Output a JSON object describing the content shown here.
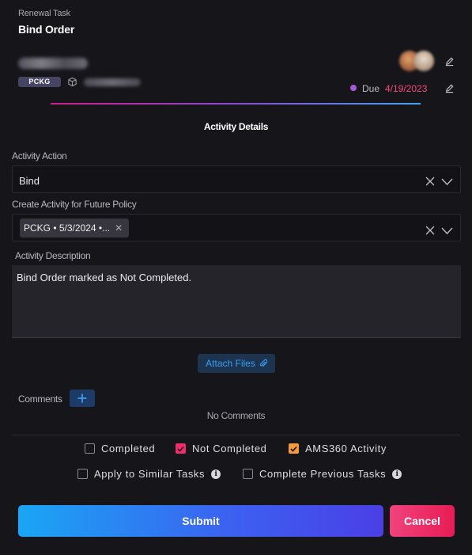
{
  "header": {
    "eyebrow": "Renewal Task",
    "title": "Bind Order",
    "badge": "PCKG",
    "due_label": "Due",
    "due_date": "4/19/2023"
  },
  "section_title": "Activity Details",
  "form": {
    "activity_action": {
      "label": "Activity Action",
      "value": "Bind"
    },
    "future_policy": {
      "label": "Create Activity for Future Policy",
      "chip": "PCKG • 5/3/2024 •..."
    },
    "description": {
      "label": "Activity Description",
      "value": "Bind Order marked as Not Completed."
    }
  },
  "attach_files_label": "Attach Files",
  "comments": {
    "label": "Comments",
    "empty": "No Comments"
  },
  "checkboxes": {
    "completed": {
      "label": "Completed",
      "checked": false
    },
    "not_completed": {
      "label": "Not Completed",
      "checked": true
    },
    "ams360": {
      "label": "AMS360 Activity",
      "checked": true
    },
    "apply_similar": {
      "label": "Apply to Similar Tasks",
      "checked": false
    },
    "complete_previous": {
      "label": "Complete Previous Tasks",
      "checked": false
    }
  },
  "actions": {
    "submit": "Submit",
    "cancel": "Cancel"
  },
  "colors": {
    "accent_pink": "#f04b78",
    "accent_blue": "#3d9cf0",
    "checkbox_pink": "#ee2d6c",
    "checkbox_orange": "#f09a3c"
  }
}
